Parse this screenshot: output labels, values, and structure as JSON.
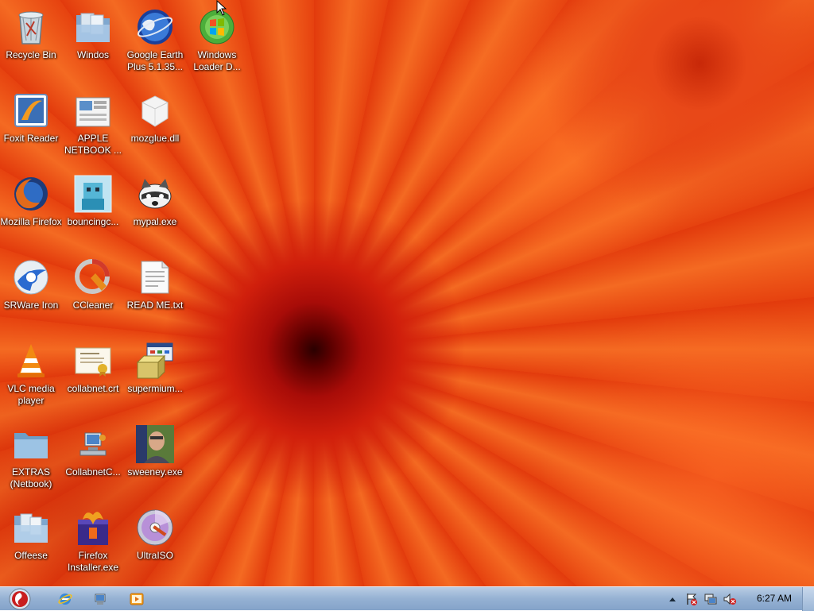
{
  "desktop": {
    "icons": [
      {
        "label": "Recycle Bin",
        "icon": "recycle-bin-icon"
      },
      {
        "label": "Windos",
        "icon": "folder-windows-icon"
      },
      {
        "label": "Google Earth Plus 5.1.35...",
        "icon": "google-earth-icon"
      },
      {
        "label": "Windows Loader D...",
        "icon": "windows-loader-icon"
      },
      {
        "label": "Foxit Reader",
        "icon": "foxit-reader-icon"
      },
      {
        "label": "APPLE NETBOOK ...",
        "icon": "document-collection-icon"
      },
      {
        "label": "mozglue.dll",
        "icon": "dll-file-icon"
      },
      {
        "label": "Mozilla Firefox",
        "icon": "firefox-icon"
      },
      {
        "label": "bouncingc...",
        "icon": "game-thumbnail-icon"
      },
      {
        "label": "mypal.exe",
        "icon": "raccoon-icon"
      },
      {
        "label": "SRWare Iron",
        "icon": "srware-iron-icon"
      },
      {
        "label": "CCleaner",
        "icon": "ccleaner-icon"
      },
      {
        "label": "READ ME.txt",
        "icon": "text-file-icon"
      },
      {
        "label": "VLC media player",
        "icon": "vlc-icon"
      },
      {
        "label": "collabnet.crt",
        "icon": "certificate-icon"
      },
      {
        "label": "supermium...",
        "icon": "installer-icon"
      },
      {
        "label": "EXTRAS (Netbook)",
        "icon": "folder-icon"
      },
      {
        "label": "CollabnetC...",
        "icon": "network-computer-icon"
      },
      {
        "label": "sweeney.exe",
        "icon": "person-photo-icon"
      },
      {
        "label": "Offeese",
        "icon": "folder-blue-icon"
      },
      {
        "label": "Firefox Installer.exe",
        "icon": "firefox-installer-icon"
      },
      {
        "label": "UltraISO",
        "icon": "disc-icon"
      }
    ]
  },
  "taskbar": {
    "start": "start-orb-icon",
    "pinned": [
      {
        "name": "internet-explorer-icon"
      },
      {
        "name": "windows-explorer-icon"
      },
      {
        "name": "media-player-icon"
      }
    ],
    "tray": {
      "clock": "6:27 AM",
      "icons": [
        "show-hidden-icon",
        "action-center-icon",
        "network-icon",
        "volume-muted-icon"
      ]
    }
  }
}
